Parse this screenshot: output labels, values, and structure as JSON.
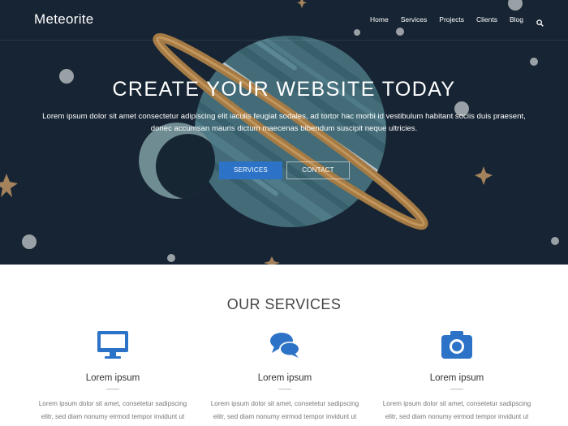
{
  "navbar": {
    "brand": "Meteorite",
    "links": [
      "Home",
      "Services",
      "Projects",
      "Clients",
      "Blog"
    ],
    "search_icon": "search-icon"
  },
  "hero": {
    "title": "CREATE YOUR WEBSITE TODAY",
    "text": "Lorem ipsum dolor sit amet consectetur adipiscing elit iaculis feugiat sodales, ad tortor hac morbi id vestibulum habitant sociis duis praesent, donec accumsan mauris dictum maecenas bibendum suscipit neque ultricies.",
    "primary_button": "SERVICES",
    "secondary_button": "CONTACT"
  },
  "services": {
    "title": "OUR SERVICES",
    "items": [
      {
        "icon": "monitor-icon",
        "name": "Lorem ipsum",
        "desc": "Lorem ipsum dolor sit amet, consetetur sadipscing elitr, sed diam nonumy eirmod tempor invidunt ut"
      },
      {
        "icon": "chat-bubbles-icon",
        "name": "Lorem ipsum",
        "desc": "Lorem ipsum dolor sit amet, consetetur sadipscing elitr, sed diam nonumy eirmod tempor invidunt ut"
      },
      {
        "icon": "camera-icon",
        "name": "Lorem ipsum",
        "desc": "Lorem ipsum dolor sit amet, consetetur sadipscing elitr, sed diam nonumy eirmod tempor invidunt ut"
      }
    ]
  },
  "colors": {
    "hero_background": "#172433",
    "accent_blue": "#2c72c6",
    "planet": "#436c78",
    "ring": "#a47a45",
    "stars": "#a4825c"
  }
}
